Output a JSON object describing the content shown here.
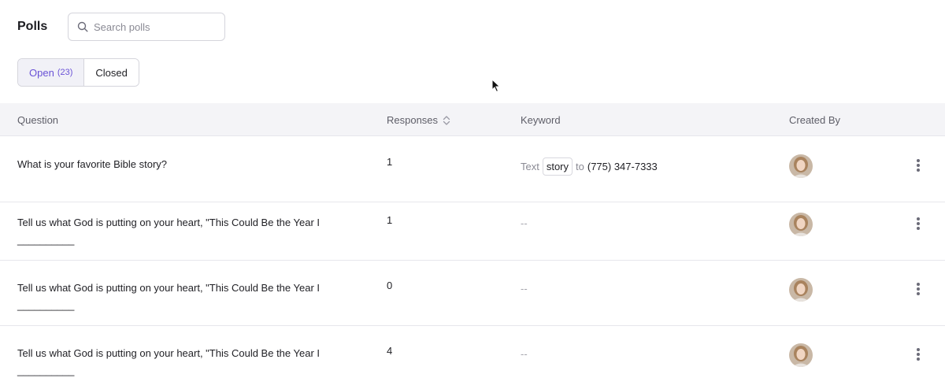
{
  "header": {
    "title": "Polls",
    "search_placeholder": "Search polls"
  },
  "tabs": [
    {
      "label": "Open",
      "count": "(23)",
      "active": true
    },
    {
      "label": "Closed",
      "active": false
    }
  ],
  "table": {
    "columns": {
      "question": "Question",
      "responses": "Responses",
      "keyword": "Keyword",
      "created_by": "Created By"
    },
    "rows": [
      {
        "question": "What is your favorite Bible story?",
        "responses": "1",
        "keyword": {
          "prefix": "Text",
          "word": "story",
          "connector": "to",
          "phone": "(775) 347-7333"
        }
      },
      {
        "question": "Tell us what God is putting on your heart, \"This Could Be the Year I __________",
        "responses": "1",
        "keyword_empty": "--"
      },
      {
        "question": "Tell us what God is putting on your heart, \"This Could Be the Year I __________",
        "responses": "0",
        "keyword_empty": "--"
      },
      {
        "question": "Tell us what God is putting on your heart, \"This Could Be the Year I __________",
        "responses": "4",
        "keyword_empty": "--"
      }
    ]
  },
  "icons": {
    "search": "search-icon",
    "sort": "sort-icon",
    "more": "more-vertical-icon",
    "avatar": "user-avatar"
  },
  "colors": {
    "accent": "#6a52d6",
    "header_bg": "#f4f4f7",
    "border": "#e6e6ec"
  }
}
